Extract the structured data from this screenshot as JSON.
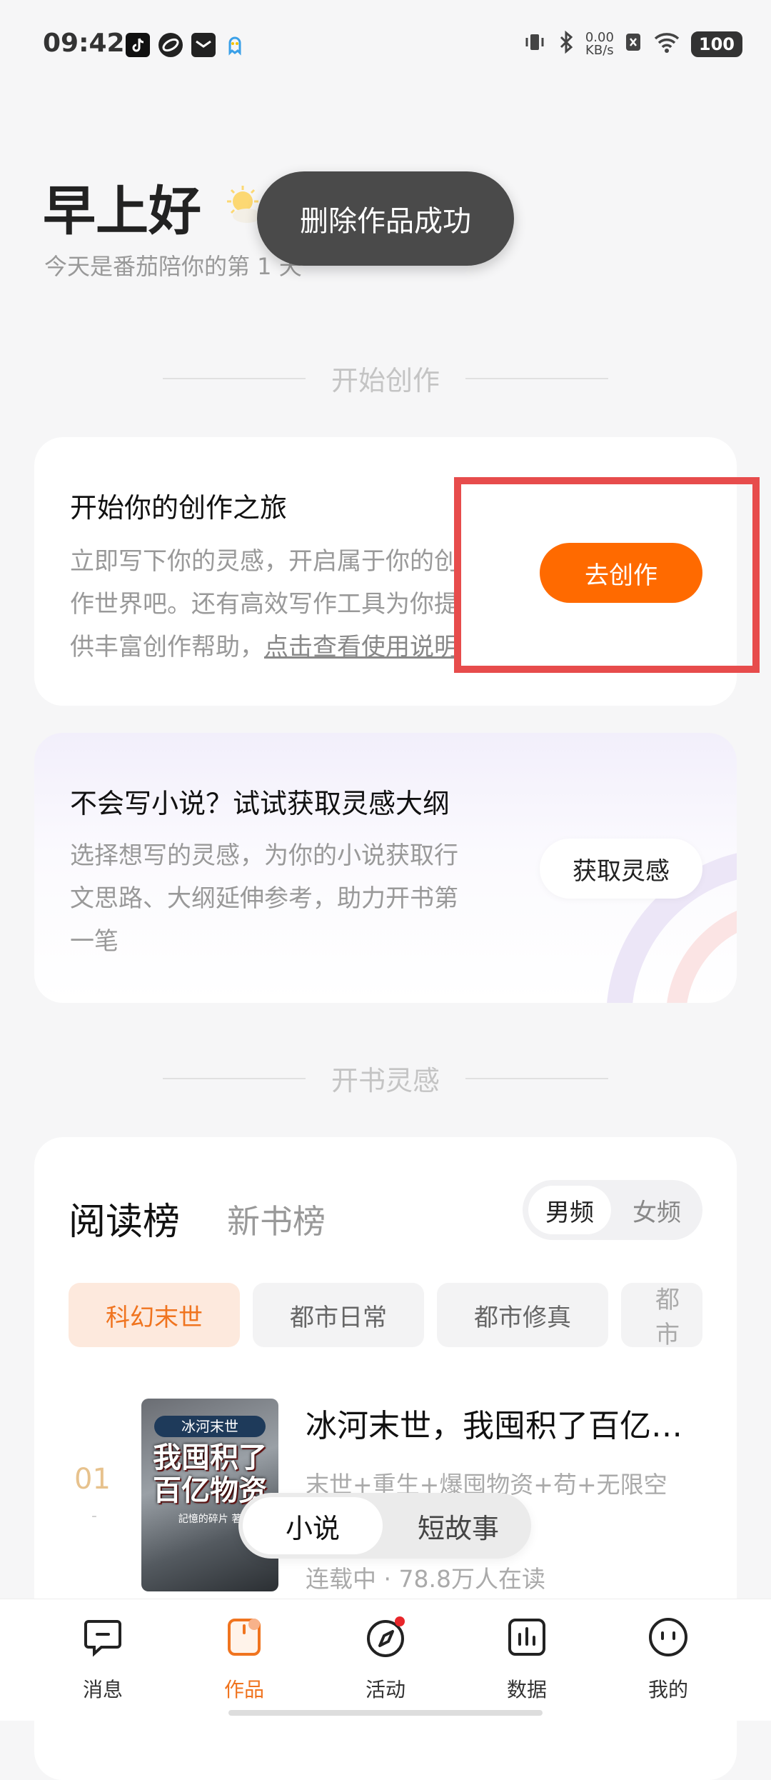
{
  "status_bar": {
    "time": "09:42",
    "net_speed_value": "0.00",
    "net_speed_unit": "KB/s",
    "battery": "100",
    "icons": [
      "tiktok-icon",
      "app-icon",
      "mail-icon",
      "ghost-icon",
      "vibrate-icon",
      "bluetooth-icon",
      "sim-off-icon",
      "wifi-icon"
    ]
  },
  "header": {
    "greeting": "早上好",
    "subtitle": "今天是番茄陪你的第 1 天"
  },
  "toast": {
    "text": "删除作品成功"
  },
  "sections": {
    "start_creation": "开始创作",
    "book_inspiration": "开书灵感"
  },
  "create_card": {
    "title": "开始你的创作之旅",
    "desc_line1": "立即写下你的灵感，开启属于你的创",
    "desc_line2": "作世界吧。还有高效写作工具为你提",
    "desc_line3_prefix": "供丰富创作帮助，",
    "desc_link": "点击查看使用说明",
    "button": "去创作"
  },
  "inspiration_card": {
    "title": "不会写小说？试试获取灵感大纲",
    "desc_line1": "选择想写的灵感，为你的小说获取行",
    "desc_line2": "文思路、大纲延伸参考，助力开书第",
    "desc_line3": "一笔",
    "button": "获取灵感"
  },
  "ranking": {
    "tabs": [
      "阅读榜",
      "新书榜"
    ],
    "gender": [
      "男频",
      "女频"
    ],
    "categories": [
      "科幻末世",
      "都市日常",
      "都市修真",
      "都市"
    ],
    "book": {
      "rank": "01",
      "rank_sub": "-",
      "cover_top": "冰河末世",
      "cover_title_1": "我囤积了",
      "cover_title_2": "百亿物资",
      "cover_author": "記憶的碎片 著",
      "title": "冰河末世，我囤积了百亿…",
      "tags": "末世+重生+爆囤物资+苟+无限空",
      "status": "连载中 · 78.8万人在读"
    }
  },
  "float_switch": [
    "小说",
    "短故事"
  ],
  "nav": [
    {
      "label": "消息",
      "icon": "message-icon"
    },
    {
      "label": "作品",
      "icon": "works-icon"
    },
    {
      "label": "活动",
      "icon": "compass-icon"
    },
    {
      "label": "数据",
      "icon": "chart-icon"
    },
    {
      "label": "我的",
      "icon": "profile-icon"
    }
  ],
  "colors": {
    "accent": "#ff6a00",
    "highlight": "#e74c4c",
    "toast": "#4a4a4a"
  }
}
